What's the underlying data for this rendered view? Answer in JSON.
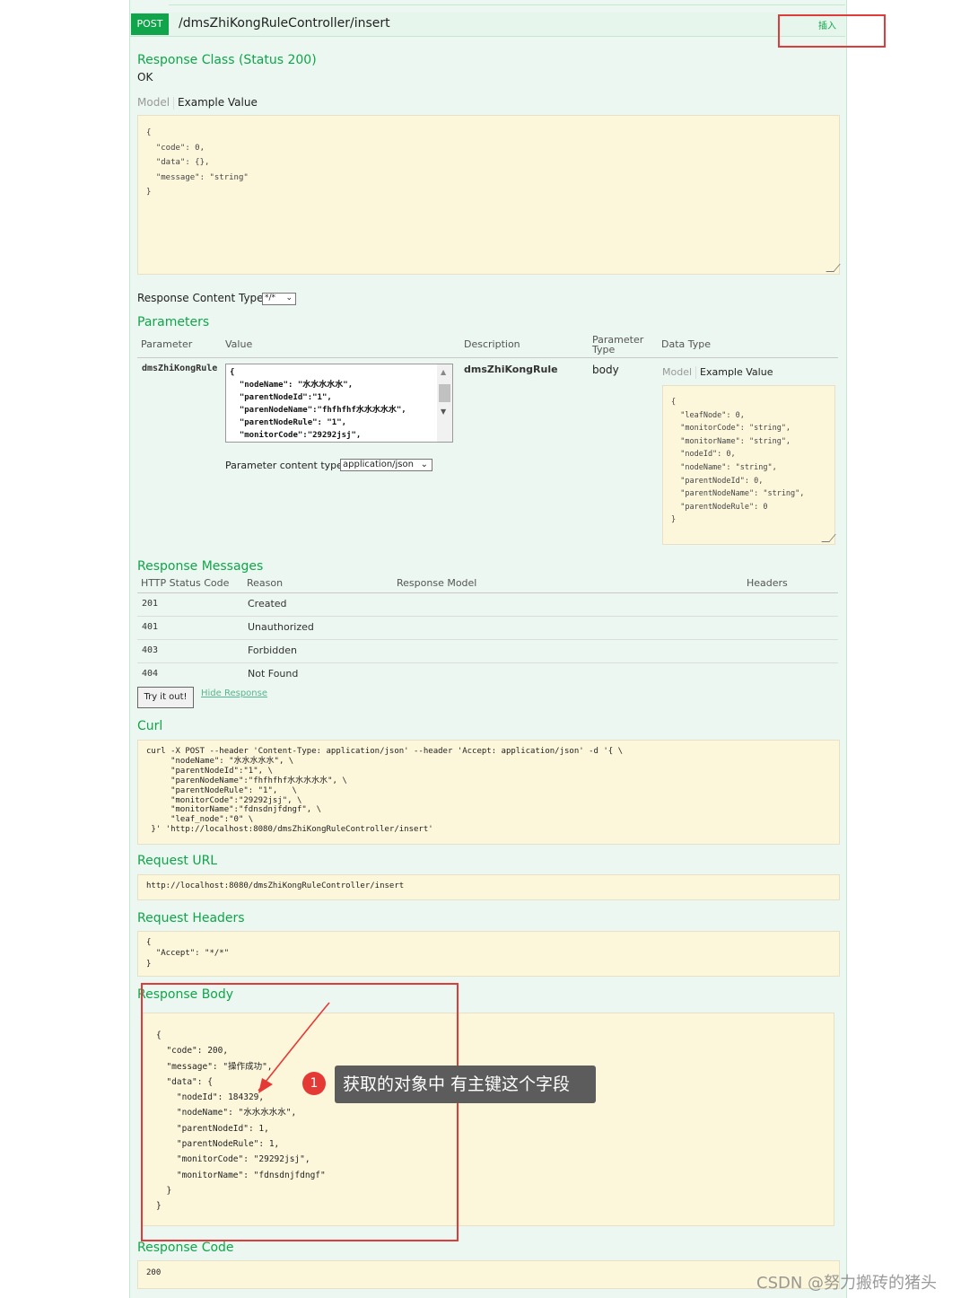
{
  "operation": {
    "method": "POST",
    "path": "/dmsZhiKongRuleController/insert",
    "summary": "插入"
  },
  "response_class": {
    "title": "Response Class (Status 200)",
    "status_text": "OK",
    "tab_model": "Model",
    "tab_example": "Example Value",
    "example_lines": [
      "{",
      "  \"code\": 0,",
      "  \"data\": {},",
      "  \"message\": \"string\"",
      "}"
    ]
  },
  "response_content_type": {
    "label": "Response Content Type",
    "selected": "*/*"
  },
  "parameters": {
    "title": "Parameters",
    "headers": [
      "Parameter",
      "Value",
      "Description",
      "Parameter Type",
      "Data Type"
    ],
    "rows": [
      {
        "name": "dmsZhiKongRule",
        "description": "dmsZhiKongRule",
        "param_type": "body",
        "value_lines": [
          "{",
          "  \"nodeName\": \"水水水水水\",",
          "  \"parentNodeId\":\"1\",",
          "  \"parenNodeName\":\"fhfhfhf水水水水水\",",
          "  \"parentNodeRule\": \"1\",",
          "  \"monitorCode\":\"29292jsj\","
        ],
        "content_type_label": "Parameter content type:",
        "content_type_selected": "application/json",
        "tab_model": "Model",
        "tab_example": "Example Value",
        "example_lines": [
          "{",
          "  \"leafNode\": 0,",
          "  \"monitorCode\": \"string\",",
          "  \"monitorName\": \"string\",",
          "  \"nodeId\": 0,",
          "  \"nodeName\": \"string\",",
          "  \"parentNodeId\": 0,",
          "  \"parentNodeName\": \"string\",",
          "  \"parentNodeRule\": 0",
          "}"
        ]
      }
    ]
  },
  "response_messages": {
    "title": "Response Messages",
    "headers": [
      "HTTP Status Code",
      "Reason",
      "Response Model",
      "Headers"
    ],
    "rows": [
      {
        "code": "201",
        "reason": "Created"
      },
      {
        "code": "401",
        "reason": "Unauthorized"
      },
      {
        "code": "403",
        "reason": "Forbidden"
      },
      {
        "code": "404",
        "reason": "Not Found"
      }
    ]
  },
  "actions": {
    "try_label": "Try it out!",
    "hide_label": "Hide Response"
  },
  "curl": {
    "title": "Curl",
    "lines": [
      "curl -X POST --header 'Content-Type: application/json' --header 'Accept: application/json' -d '{ \\",
      "     \"nodeName\": \"水水水水水\", \\",
      "     \"parentNodeId\":\"1\", \\",
      "     \"parenNodeName\":\"fhfhfhf水水水水水\", \\",
      "     \"parentNodeRule\": \"1\",   \\",
      "     \"monitorCode\":\"29292jsj\", \\",
      "     \"monitorName\":\"fdnsdnjfdngf\", \\",
      "     \"leaf_node\":\"0\" \\",
      " }' 'http://localhost:8080/dmsZhiKongRuleController/insert'"
    ]
  },
  "request_url": {
    "title": "Request URL",
    "value": "http://localhost:8080/dmsZhiKongRuleController/insert"
  },
  "request_headers": {
    "title": "Request Headers",
    "lines": [
      "{",
      "  \"Accept\": \"*/*\"",
      "}"
    ]
  },
  "response_body": {
    "title": "Response Body",
    "lines": [
      "{",
      "  \"code\": 200,",
      "  \"message\": \"操作成功\",",
      "  \"data\": {",
      "    \"nodeId\": 184329,",
      "    \"nodeName\": \"水水水水水\",",
      "    \"parentNodeId\": 1,",
      "    \"parentNodeRule\": 1,",
      "    \"monitorCode\": \"29292jsj\",",
      "    \"monitorName\": \"fdnsdnjfdngf\"",
      "  }",
      "}"
    ]
  },
  "response_code": {
    "title": "Response Code",
    "value": "200"
  },
  "annotation": {
    "number": "1",
    "text": "获取的对象中 有主键这个字段"
  },
  "watermark": "CSDN @努力搬砖的猪头"
}
